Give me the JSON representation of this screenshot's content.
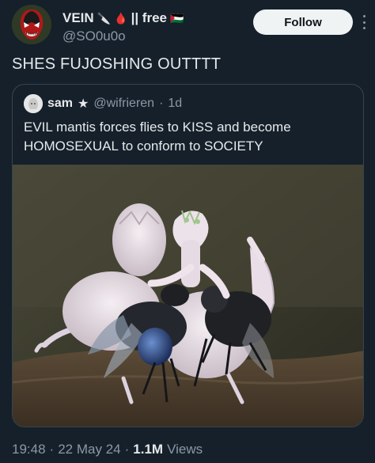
{
  "header": {
    "display_name": "VEIN",
    "name_emoji_1": "🔪",
    "name_emoji_2": "🩸",
    "name_suffix": "|| free",
    "name_emoji_3": "🇵🇸",
    "handle": "@SO0u0o",
    "follow_label": "Follow"
  },
  "tweet": {
    "text": "SHES FUJOSHING OUTTTT"
  },
  "quote": {
    "name": "sam",
    "star": "★",
    "handle": "@wifrieren",
    "separator": "·",
    "time": "1d",
    "text": "EVIL mantis forces flies to KISS and become HOMOSEXUAL to conform to SOCIETY"
  },
  "meta": {
    "time": "19:48",
    "sep1": "·",
    "date": "22 May 24",
    "sep2": "·",
    "views_count": "1.1M",
    "views_label": "Views"
  },
  "colors": {
    "background": "#15202b",
    "text": "#e7e9ea",
    "muted": "#8b98a5",
    "border": "#38444d",
    "follow_bg": "#eff3f4"
  }
}
